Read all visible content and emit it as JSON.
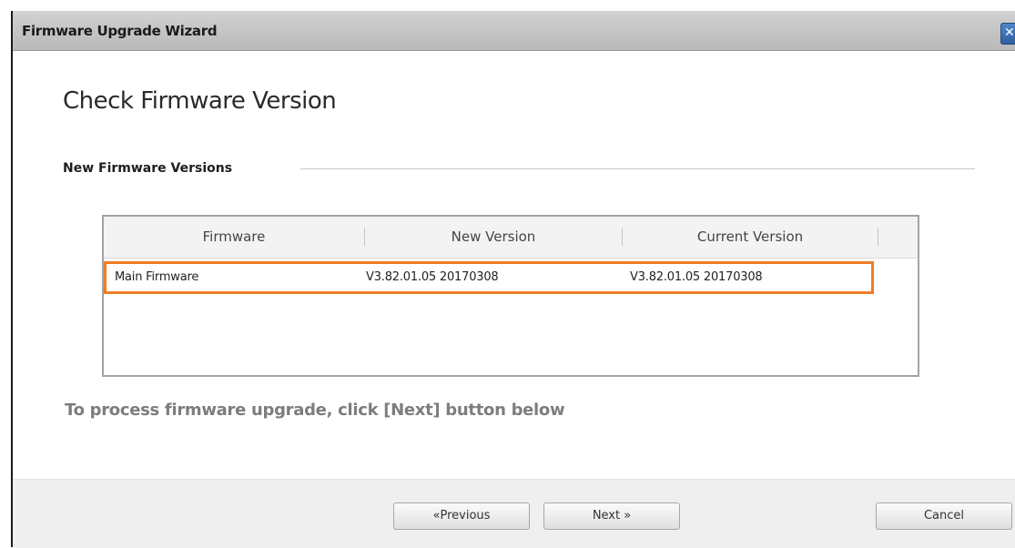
{
  "window": {
    "title": "Firmware Upgrade Wizard",
    "close_glyph": "✕"
  },
  "page": {
    "heading": "Check Firmware Version",
    "section_title": "New Firmware Versions",
    "instruction": "To process firmware upgrade, click [Next] button below"
  },
  "table": {
    "columns": [
      "Firmware",
      "New Version",
      "Current Version"
    ],
    "rows": [
      {
        "firmware": "Main Firmware",
        "new_version": "V3.82.01.05 20170308",
        "current_version": "V3.82.01.05 20170308"
      }
    ]
  },
  "buttons": {
    "previous": "«Previous",
    "next": "Next »",
    "cancel": "Cancel"
  },
  "colors": {
    "highlight": "#ee7d27",
    "close_button": "#3a6fb0"
  },
  "icons": {
    "close": "close-icon"
  }
}
